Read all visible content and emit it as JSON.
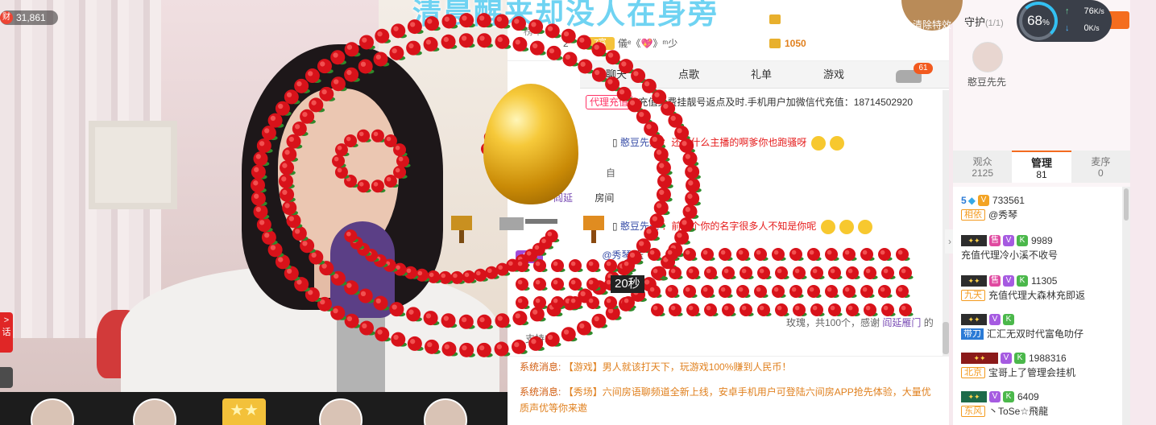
{
  "video": {
    "wealth_label": "财",
    "wealth_count": "31,861",
    "side_badge_text": "话",
    "timer": "20秒"
  },
  "banner": {
    "text": "清晨醒来却没人在身旁"
  },
  "rank": {
    "tab_label": "榜单",
    "row_number": "2",
    "badge_label": "7富",
    "user_name": "儀ᵉ《💖》ᵐ少",
    "coin_value": "1050"
  },
  "chat_tabs": [
    "聊天",
    "点歌",
    "礼单",
    "游戏"
  ],
  "car_badge": "61",
  "messages": {
    "agent": {
      "pill": "代理充值",
      "text": "充值免费挂靓号返点及时.手机用户加微信代充值：18714502920"
    },
    "m1": {
      "user": "憨豆先先",
      "text": "：还说什么主播的啊爹你也跑骚呀"
    },
    "m2": {
      "fragment": "阎延",
      "tail": "房间",
      "top": "自"
    },
    "m3": {
      "user": "憨豆先先",
      "text": "：前改个你的名字很多人不知是你呢"
    },
    "gift": {
      "lvl": "8富",
      "target": "@秀琴",
      "verb": "送"
    },
    "gift_done": {
      "text": "玫瑰，共100个，感谢",
      "user": "阎延雁门",
      "tail": "的",
      "line2": "支持!"
    }
  },
  "system": {
    "s1": {
      "label": "系统消息:",
      "text": "【游戏】男人就该打天下，玩游戏100%赚到人民币！"
    },
    "s2": {
      "label": "系统消息:",
      "text": "【秀场】六间房语聊频道全新上线，安卓手机用户可登陆六间房APP抢先体验，大量优质声优等你来邀"
    }
  },
  "right": {
    "clear_fx": "清除特效",
    "guard_title": "守护",
    "guard_count": "(1/1)",
    "guard_name": "憨豆先先",
    "net_percent": "68",
    "net_percent_unit": "%",
    "net_up": "76",
    "net_down": "0",
    "net_unit": "K/s",
    "tabs": [
      {
        "label": "观众",
        "count": "2125"
      },
      {
        "label": "管理",
        "count": "81"
      },
      {
        "label": "麦序",
        "count": "0"
      }
    ],
    "users": [
      {
        "lvl": "5",
        "id": "733561",
        "tag": "相依",
        "name": "@秀琴"
      },
      {
        "tag_top": "售",
        "id": "9989",
        "name": "充值代理冷小溪不收号"
      },
      {
        "tag_top": "售",
        "id": "11305",
        "tag": "九天",
        "name": "充值代理大森林充即返"
      },
      {
        "tag": "带刀",
        "name": "汇汇无双时代富龟叻仔"
      },
      {
        "id": "1988316",
        "tag": "北京",
        "name": "宝哥上了管理会挂机"
      },
      {
        "id": "6409",
        "tag": "东风",
        "name": "丶ToSe☆飛龍"
      }
    ]
  },
  "thumbs_star": "★★"
}
